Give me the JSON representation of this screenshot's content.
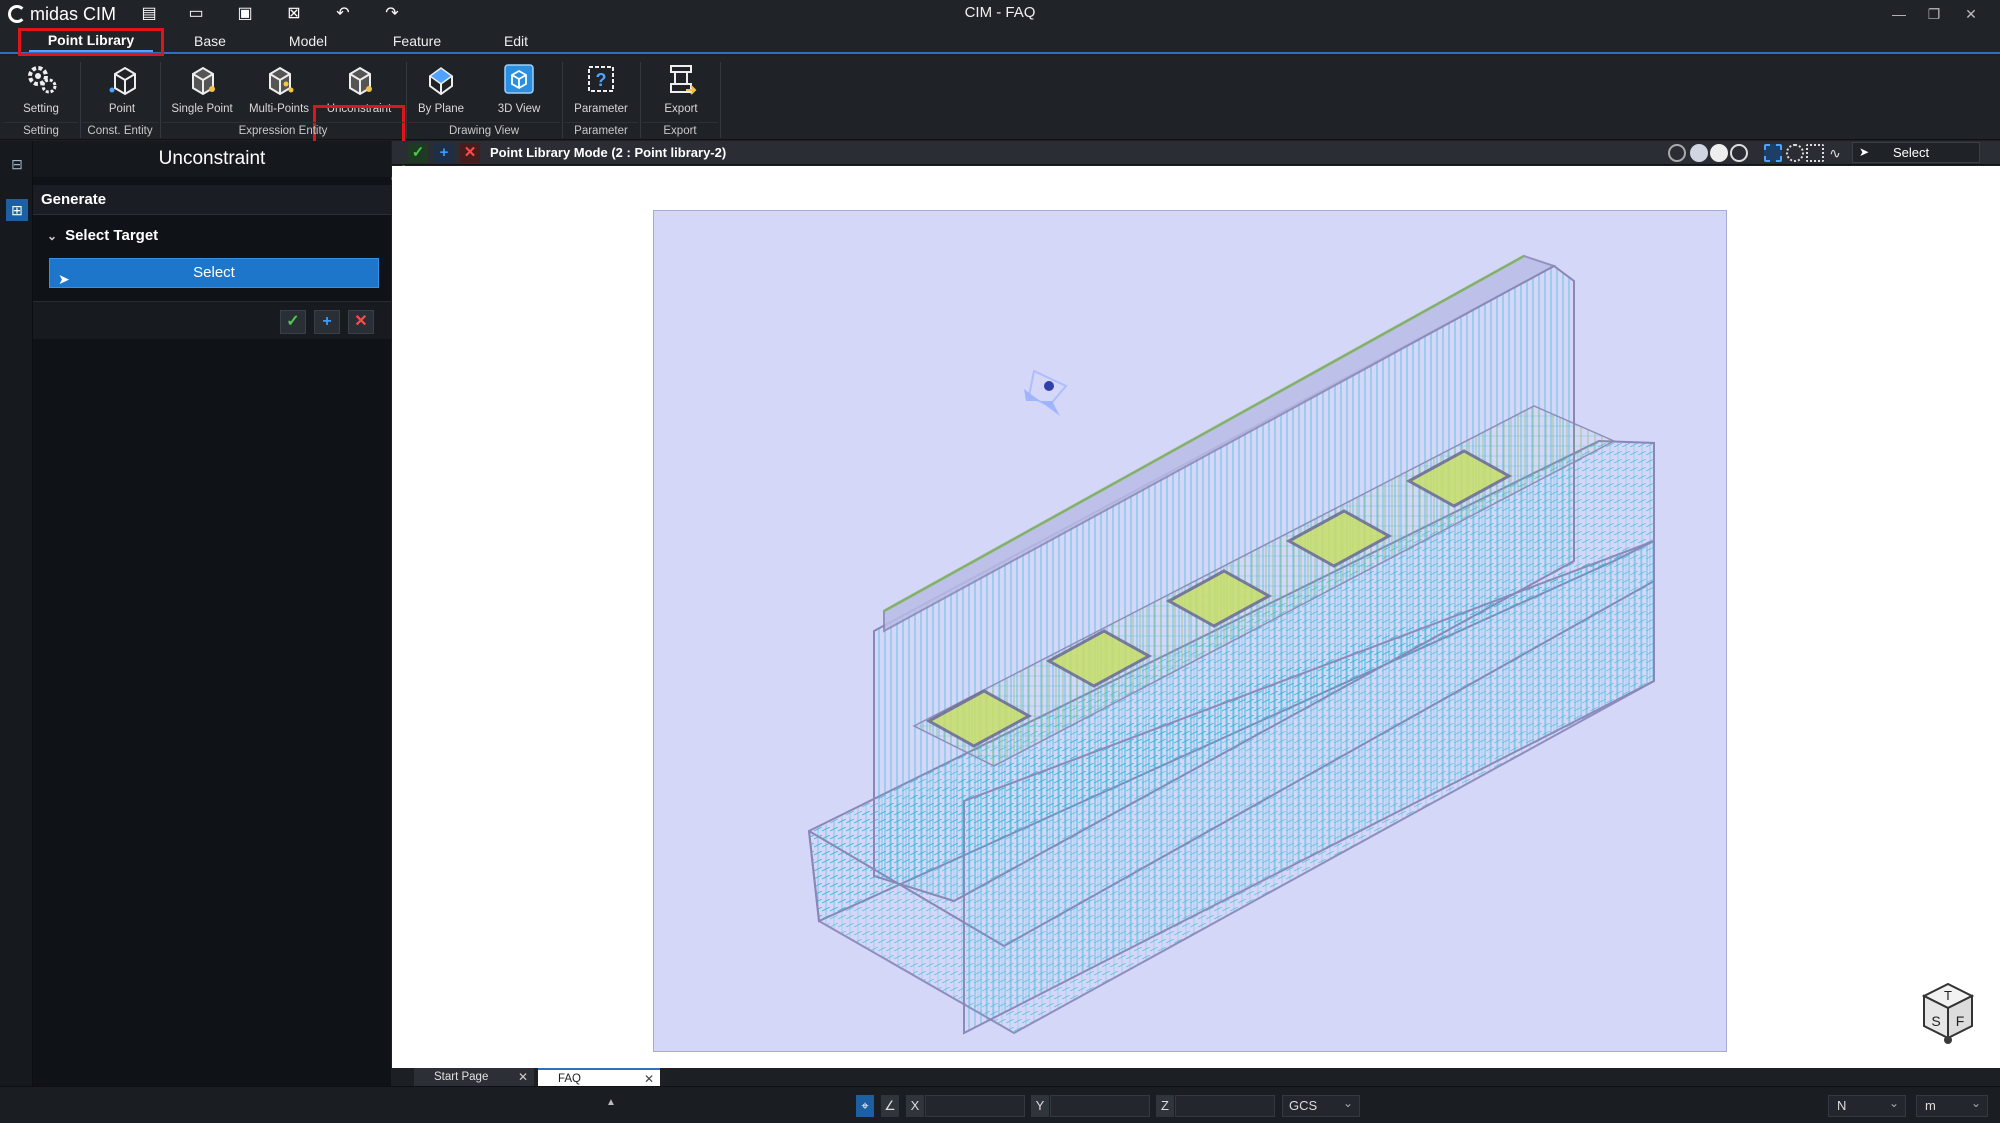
{
  "app": {
    "logo_text": "midas CIM",
    "window_title": "CIM - FAQ"
  },
  "menu": {
    "tabs": [
      "Point Library",
      "Base",
      "Model",
      "Feature",
      "Edit"
    ]
  },
  "ribbon": {
    "buttons": {
      "setting": "Setting",
      "point": "Point",
      "single_point": "Single Point",
      "multi_points": "Multi-Points",
      "unconstraint": "Unconstraint",
      "by_plane": "By Plane",
      "view_3d": "3D View",
      "parameter": "Parameter",
      "export": "Export"
    },
    "groups": {
      "setting": "Setting",
      "const_entity": "Const. Entity",
      "expression_entity": "Expression Entity",
      "drawing_view": "Drawing View",
      "parameter": "Parameter",
      "export": "Export"
    }
  },
  "panel": {
    "title": "Unconstraint",
    "section": "Generate",
    "subsection": "Select Target",
    "select_button": "Select"
  },
  "viewport": {
    "mode_label": "Point Library Mode (2 : Point library-2)",
    "select_label": "Select",
    "background_color": "#d4d7f8"
  },
  "doc_tabs": [
    "Start Page",
    "FAQ"
  ],
  "status": {
    "x_label": "X",
    "y_label": "Y",
    "z_label": "Z",
    "x_value": "",
    "y_value": "",
    "z_value": "",
    "coord_system": "GCS",
    "force_unit": "N",
    "length_unit": "m"
  },
  "navcube": {
    "top": "T",
    "left": "S",
    "right": "F"
  }
}
